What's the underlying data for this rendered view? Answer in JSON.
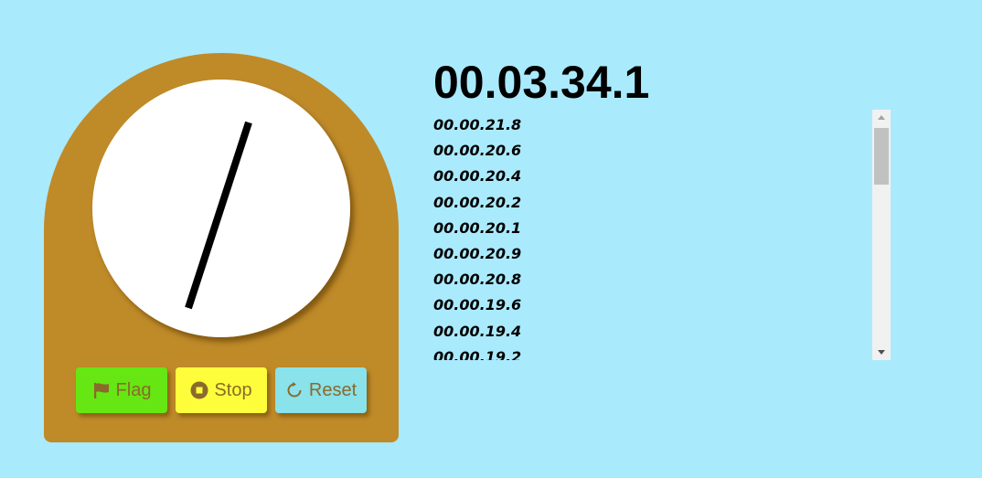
{
  "stopwatch": {
    "main_time": "00.03.34.1",
    "buttons": {
      "flag_label": "Flag",
      "stop_label": "Stop",
      "reset_label": "Reset"
    },
    "icons": {
      "flag": "flag-icon",
      "stop": "stop-circle-icon",
      "reset": "reset-icon",
      "scroll_up": "scroll-up-arrow-icon",
      "scroll_down": "scroll-down-arrow-icon"
    },
    "laps": [
      "00.00.21.8",
      "00.00.20.6",
      "00.00.20.4",
      "00.00.20.2",
      "00.00.20.1",
      "00.00.20.9",
      "00.00.20.8",
      "00.00.19.6",
      "00.00.19.4",
      "00.00.19.2"
    ]
  },
  "colors": {
    "background": "#aaeafd",
    "body": "#bf8a28",
    "dial": "#ffffff",
    "flag_button": "#66e612",
    "stop_button": "#fdfd3c",
    "reset_button": "#8ae2ea",
    "button_text": "#8a6a2a"
  }
}
